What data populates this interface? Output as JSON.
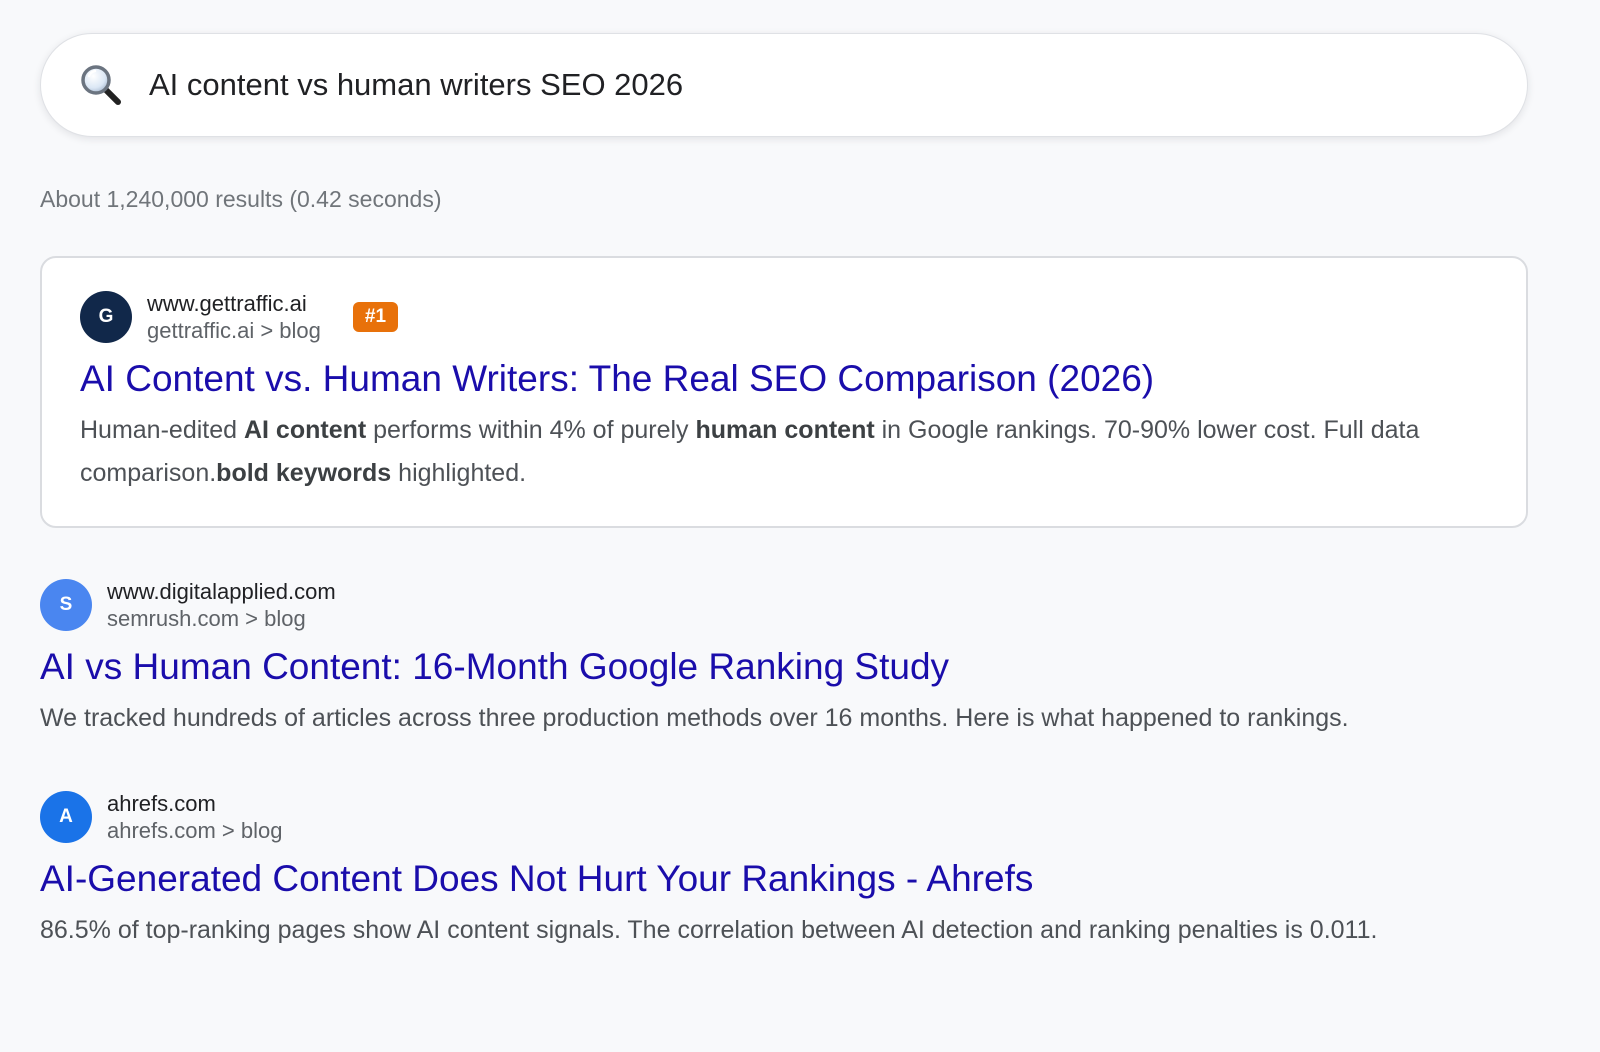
{
  "search": {
    "query": "AI content vs human writers SEO 2026",
    "icon": "search-icon"
  },
  "stats": "About 1,240,000 results (0.42 seconds)",
  "results": [
    {
      "favicon_letter": "G",
      "favicon_color": "#11284a",
      "domain": "www.gettraffic.ai",
      "breadcrumb": "gettraffic.ai > blog",
      "badge": "#1",
      "badge_color": "#e8710a",
      "title": "AI Content vs. Human Writers: The Real SEO Comparison (2026)",
      "snippet": {
        "t1": "Human-edited ",
        "b1": "AI content",
        "t2": " performs within 4% of purely ",
        "b2": "human content",
        "t3": " in Google rankings. 70-90% lower cost. Full data comparison.",
        "b3": "bold keywords",
        "t4": " highlighted."
      }
    },
    {
      "favicon_letter": "S",
      "favicon_color": "#4a86f0",
      "domain": "www.digitalapplied.com",
      "breadcrumb": "semrush.com > blog",
      "title": "AI vs Human Content: 16-Month Google Ranking Study",
      "snippet": "We tracked hundreds of articles across three production methods over 16 months. Here is what happened to rankings."
    },
    {
      "favicon_letter": "A",
      "favicon_color": "#1a73e8",
      "domain": "ahrefs.com",
      "breadcrumb": "ahrefs.com > blog",
      "title": "AI-Generated Content Does Not Hurt Your Rankings - Ahrefs",
      "snippet": "86.5% of top-ranking pages show AI content signals. The correlation between AI detection and ranking penalties is 0.011."
    }
  ],
  "colors": {
    "link": "#1a0dab",
    "background": "#f8f9fb",
    "snippet_text": "#4d5156"
  }
}
